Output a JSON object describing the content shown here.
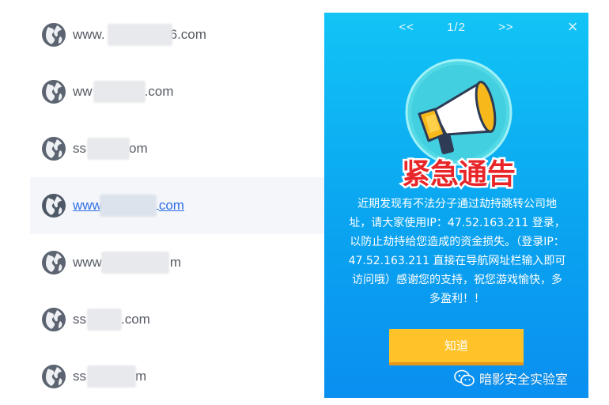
{
  "sites": [
    {
      "prefix": "www.",
      "suffix": "6.com",
      "active": false
    },
    {
      "prefix": "ww",
      "suffix": ".com",
      "active": false
    },
    {
      "prefix": "ss",
      "suffix": "om",
      "active": false
    },
    {
      "prefix": "www",
      "suffix": "com",
      "active": true
    },
    {
      "prefix": "www",
      "suffix": "m",
      "active": false
    },
    {
      "prefix": "ss",
      "suffix": ".com",
      "active": false
    },
    {
      "prefix": "ss",
      "suffix": "m",
      "active": false
    }
  ],
  "popup": {
    "prev_label": "<<",
    "page_indicator": "1/2",
    "next_label": ">>",
    "close_label": "×",
    "banner_text": "紧急通告",
    "message": "近期发现有不法分子通过劫持跳转公司地址，请大家使用IP：47.52.163.211 登录，以防止劫持给您造成的资金损失。（登录IP：47.52.163.211 直接在导航网址栏输入即可访问哦）感谢您的支持，祝您游戏愉快，多多盈利！！",
    "confirm_label": "知道"
  },
  "watermark": {
    "text": "暗影安全实验室"
  },
  "colors": {
    "popup_blue": "#0aa4f0",
    "button_yellow": "#ffc228",
    "banner_red": "#e8262a",
    "link_blue": "#2f6ee6"
  }
}
